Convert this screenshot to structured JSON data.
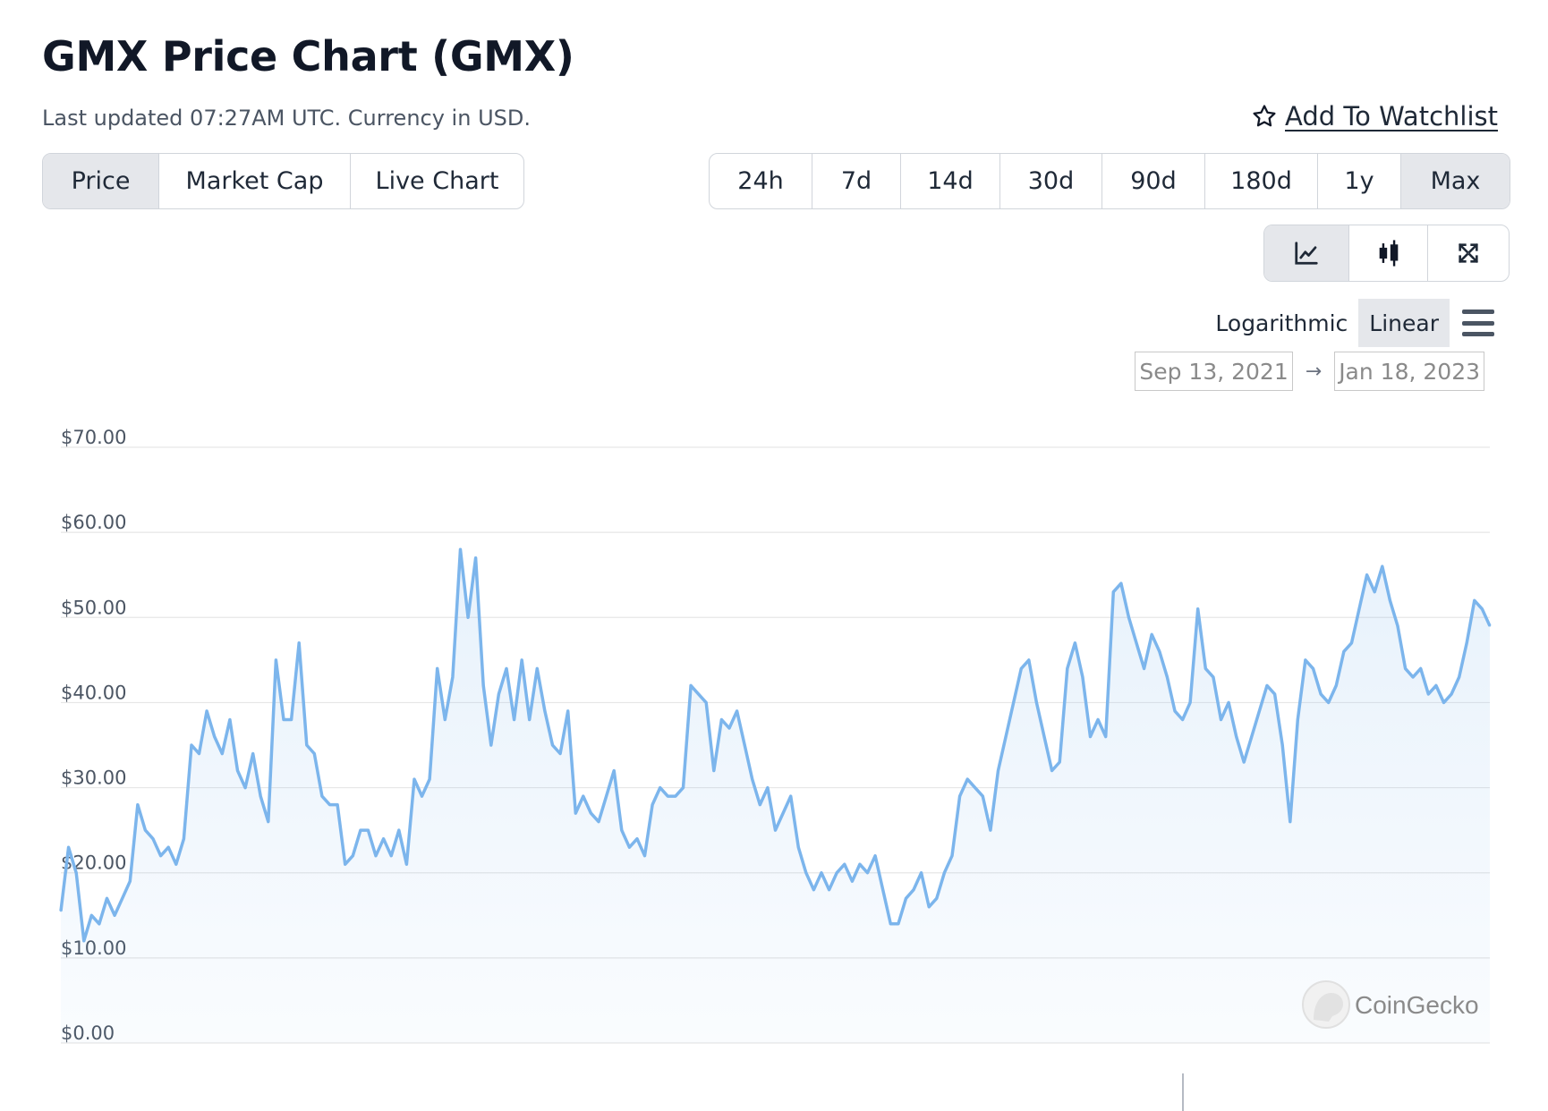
{
  "header": {
    "title": "GMX Price Chart (GMX)",
    "subtitle": "Last updated 07:27AM UTC. Currency in USD.",
    "watchlist_label": "Add To Watchlist",
    "watchlist_icon": "star-outline-icon"
  },
  "metric_tabs": [
    {
      "label": "Price",
      "active": true
    },
    {
      "label": "Market Cap",
      "active": false
    },
    {
      "label": "Live Chart",
      "active": false
    }
  ],
  "range_tabs": [
    {
      "label": "24h",
      "active": false
    },
    {
      "label": "7d",
      "active": false
    },
    {
      "label": "14d",
      "active": false
    },
    {
      "label": "30d",
      "active": false
    },
    {
      "label": "90d",
      "active": false
    },
    {
      "label": "180d",
      "active": false
    },
    {
      "label": "1y",
      "active": false
    },
    {
      "label": "Max",
      "active": true
    }
  ],
  "view_tabs": [
    {
      "icon": "line-chart-icon",
      "active": true
    },
    {
      "icon": "candlestick-icon",
      "active": false
    },
    {
      "icon": "fullscreen-icon",
      "active": false
    }
  ],
  "scale": {
    "logarithmic_label": "Logarithmic",
    "linear_label": "Linear",
    "active": "Linear",
    "menu_icon": "hamburger-menu-icon"
  },
  "date_range": {
    "from": "Sep 13, 2021",
    "arrow": "→",
    "to": "Jan 18, 2023"
  },
  "watermark": {
    "text": "CoinGecko",
    "icon": "coingecko-logo"
  },
  "colors": {
    "line": "#7cb5ec",
    "grid": "#e6e6e6",
    "active_tab_bg": "#e5e7eb"
  },
  "chart_data": {
    "type": "area",
    "title": "",
    "xlabel": "",
    "ylabel": "",
    "x_start": "Sep 13, 2021",
    "x_end": "Jan 18, 2023",
    "ylim": [
      0,
      70
    ],
    "y_ticks": [
      "$0.00",
      "$10.00",
      "$20.00",
      "$30.00",
      "$40.00",
      "$50.00",
      "$60.00",
      "$70.00"
    ],
    "y_tick_values": [
      0,
      10,
      20,
      30,
      40,
      50,
      60,
      70
    ],
    "grid": true,
    "legend": "none",
    "series": [
      {
        "values": [
          15.5,
          23,
          20,
          12,
          15,
          14,
          17,
          15,
          17,
          19,
          28,
          25,
          24,
          22,
          23,
          21,
          24,
          35,
          34,
          39,
          36,
          34,
          38,
          32,
          30,
          34,
          29,
          26,
          45,
          38,
          38,
          47,
          35,
          34,
          29,
          28,
          28,
          21,
          22,
          25,
          25,
          22,
          24,
          22,
          25,
          21,
          31,
          29,
          31,
          44,
          38,
          43,
          58,
          50,
          57,
          42,
          35,
          41,
          44,
          38,
          45,
          38,
          44,
          39,
          35,
          34,
          39,
          27,
          29,
          27,
          26,
          29,
          32,
          25,
          23,
          24,
          22,
          28,
          30,
          29,
          29,
          30,
          42,
          41,
          40,
          32,
          38,
          37,
          39,
          35,
          31,
          28,
          30,
          25,
          27,
          29,
          23,
          20,
          18,
          20,
          18,
          20,
          21,
          19,
          21,
          20,
          22,
          18,
          14,
          14,
          17,
          18,
          20,
          16,
          17,
          20,
          22,
          29,
          31,
          30,
          29,
          25,
          32,
          36,
          40,
          44,
          45,
          40,
          36,
          32,
          33,
          44,
          47,
          43,
          36,
          38,
          36,
          53,
          54,
          50,
          47,
          44,
          48,
          46,
          43,
          39,
          38,
          40,
          51,
          44,
          43,
          38,
          40,
          36,
          33,
          36,
          39,
          42,
          41,
          35,
          26,
          38,
          45,
          44,
          41,
          40,
          42,
          46,
          47,
          51,
          55,
          53,
          56,
          52,
          49,
          44,
          43,
          44,
          41,
          42,
          40,
          41,
          43,
          47,
          52,
          51,
          49
        ]
      }
    ]
  }
}
